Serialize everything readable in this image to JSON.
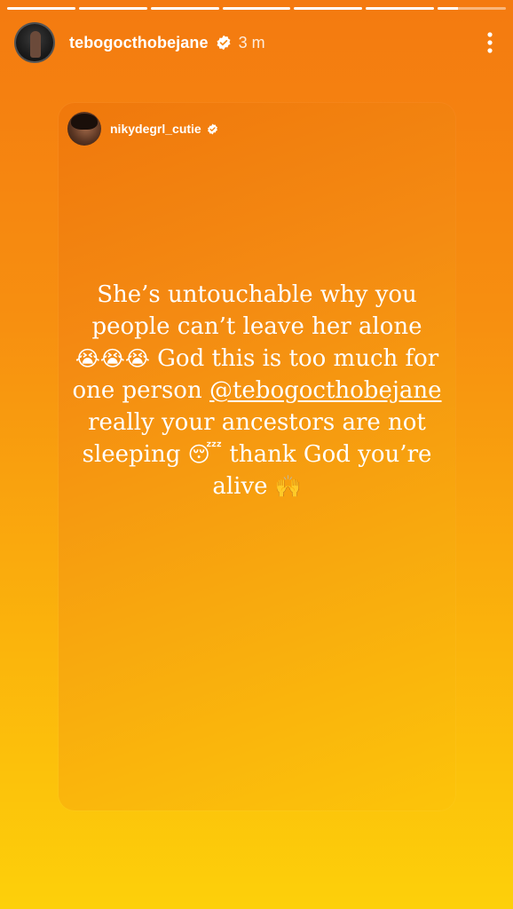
{
  "story": {
    "progress": [
      {
        "fraction": 1.0
      },
      {
        "fraction": 1.0
      },
      {
        "fraction": 1.0
      },
      {
        "fraction": 1.0
      },
      {
        "fraction": 1.0
      },
      {
        "fraction": 1.0
      },
      {
        "fraction": 0.3
      }
    ],
    "header": {
      "username": "tebogocthobejane",
      "time": "3 m"
    },
    "shared_post": {
      "username": "nikydegrl_cutie",
      "text": {
        "line_1": "She’s untouchable why you people can’t leave her alone",
        "emoji_cry": "😭😭😭",
        "line_2": " God this is too much for one person ",
        "mention": "@tebogocthobejane",
        "line_3": " really your ancestors are not sleeping ",
        "emoji_sleep": "😴",
        "line_4": " thank God you’re alive ",
        "emoji_hands": "🙌"
      }
    },
    "colors": {
      "gradient_top": "#f47a10",
      "gradient_bottom": "#fdd00a",
      "verified_blue": "#3897f0"
    }
  }
}
